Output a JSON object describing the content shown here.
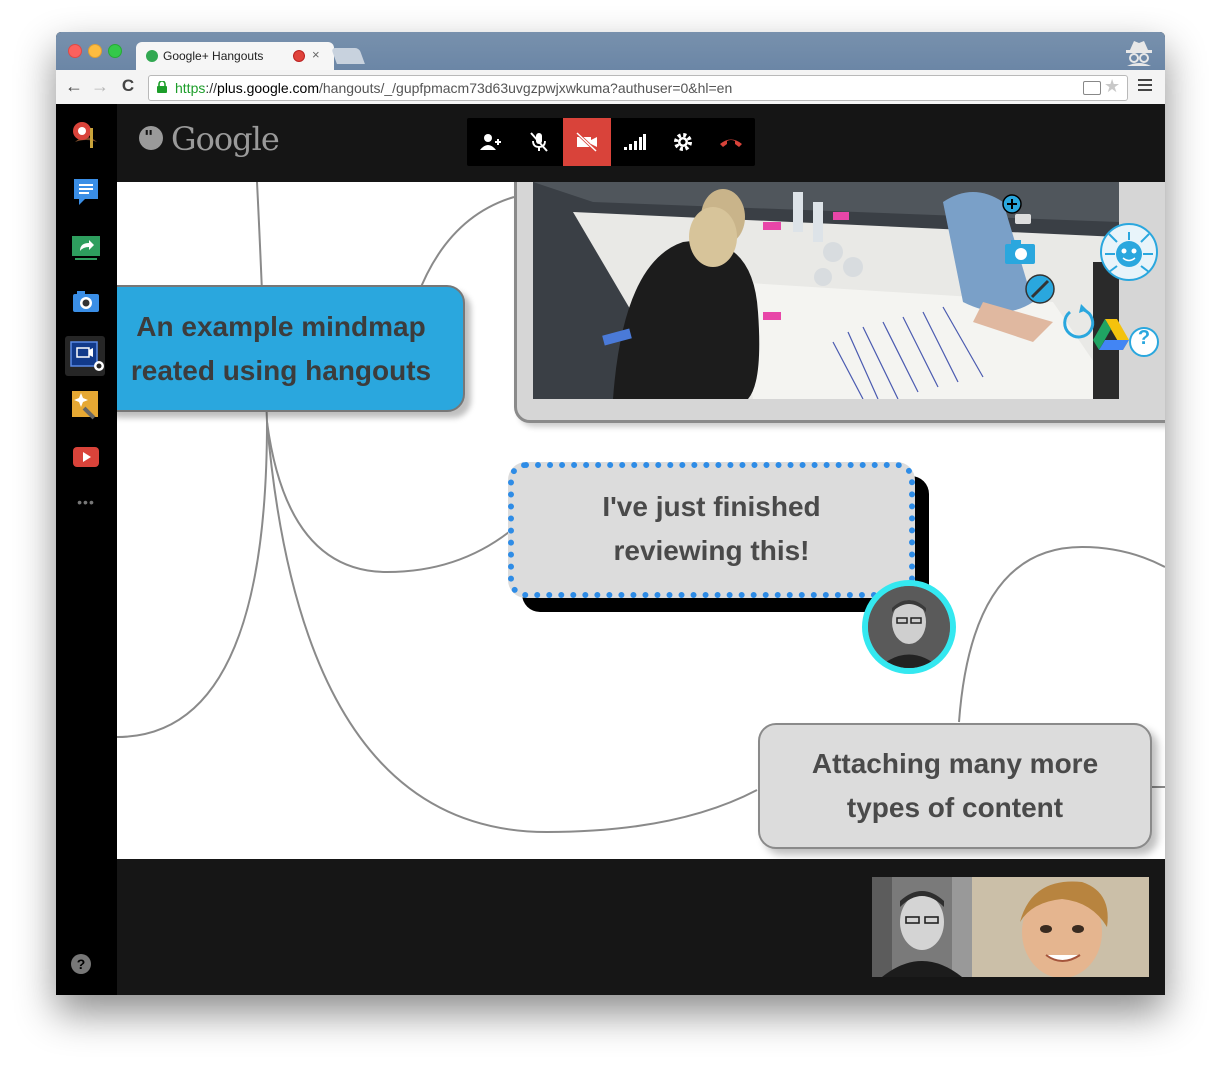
{
  "browser": {
    "tab_title": "Google+ Hangouts",
    "tab_close": "×",
    "url_scheme": "https",
    "url_sep": "://",
    "url_host": "plus.google.com",
    "url_path": "/hangouts/_/gupfpmacm73d63uvgzpwjxwkuma?authuser=0&hl=en",
    "nav_icons": [
      "back-arrow-icon",
      "forward-arrow-icon",
      "reload-icon"
    ],
    "back_glyph": "←",
    "forward_glyph": "→",
    "reload_glyph": "C",
    "star_glyph": "★"
  },
  "hangout": {
    "brand_text": "Google",
    "brand_glyph": "\"",
    "callbar_icons": [
      "invite-person-icon",
      "mic-muted-icon",
      "camera-off-icon",
      "bandwidth-icon",
      "settings-gear-icon",
      "hang-up-icon"
    ],
    "callbar_active": "camera-off-icon",
    "sidebar_icons": [
      "app-badge-icon",
      "chat-icon",
      "screenshare-icon",
      "camera-icon",
      "mindmap-app-icon",
      "effects-icon",
      "youtube-icon",
      "more-dots-icon"
    ],
    "sidebar_more": "•••",
    "help_label": "?"
  },
  "mindmap": {
    "node_example": [
      "An example mindmap",
      "reated using hangouts"
    ],
    "node_review": [
      "I've just finished",
      "reviewing this!"
    ],
    "node_attach": [
      "Attaching many more",
      "types of content"
    ],
    "toolbox_icons": [
      "add-node-icon",
      "camera-icon",
      "pen-icon",
      "refresh-icon",
      "drive-icon",
      "help-circle-icon",
      "bug-mascot-icon"
    ],
    "toolbox_help": "?"
  },
  "colors": {
    "accent_blue": "#2aa7de",
    "active_red": "#d9433a",
    "avatar_ring": "#34e8f0",
    "dotted_border": "#2e8ce6"
  }
}
